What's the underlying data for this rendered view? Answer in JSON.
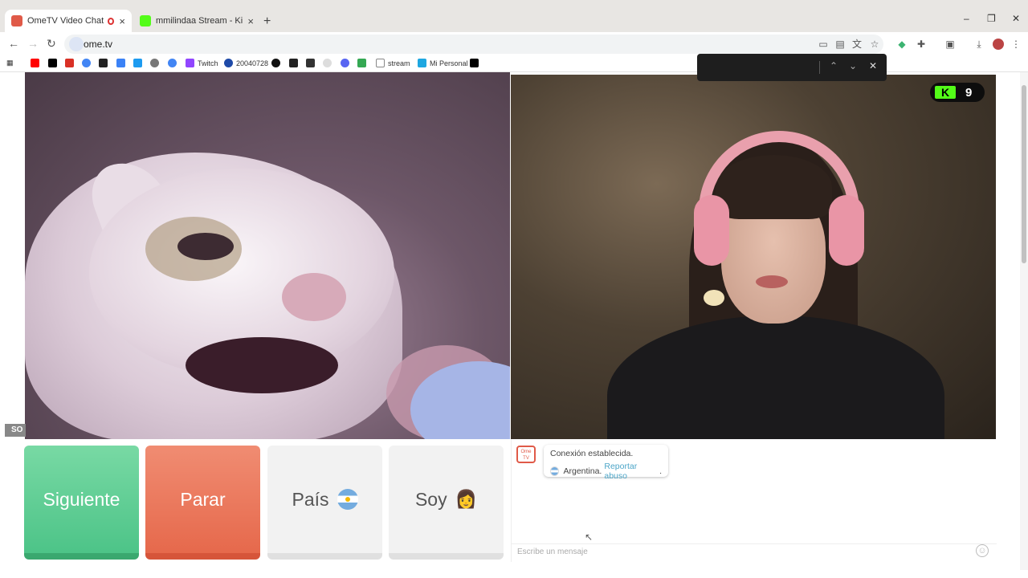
{
  "tabs": [
    {
      "title": "OmeTV Video Chat — Ome",
      "close": "×",
      "color": "#e05a48"
    },
    {
      "title": "mmilindaa Stream - Kick Dashb",
      "close": "×",
      "color": "#53fc18"
    }
  ],
  "new_tab": "+",
  "window_controls": {
    "minimize": "–",
    "maximize": "❐",
    "close": "✕"
  },
  "address": {
    "url": "ome.tv"
  },
  "bookmarks": [
    {
      "label": "",
      "color": "#ff0000"
    },
    {
      "label": "",
      "color": "#000000"
    },
    {
      "label": "",
      "color": "#d93025"
    },
    {
      "label": "",
      "color": "#4285f4"
    },
    {
      "label": "",
      "color": "#222222"
    },
    {
      "label": "",
      "color": "#3b82f6"
    },
    {
      "label": "",
      "color": "#1d9bf0"
    },
    {
      "label": "",
      "color": "#777777"
    },
    {
      "label": "",
      "color": "#4285f4"
    },
    {
      "label": "Twitch",
      "color": "#9146ff"
    },
    {
      "label": "20040728",
      "color": "#1e4aa8"
    },
    {
      "label": "",
      "color": "#111111"
    },
    {
      "label": "",
      "color": "#222222"
    },
    {
      "label": "",
      "color": "#333333"
    },
    {
      "label": "",
      "color": "#dddddd"
    },
    {
      "label": "",
      "color": "#5865f2"
    },
    {
      "label": "",
      "color": "#34a853"
    },
    {
      "label": "stream",
      "color": "#888888"
    },
    {
      "label": "Mi Personal",
      "color": "#1ea7e1"
    },
    {
      "label": "",
      "color": "#000000"
    }
  ],
  "findbar": {
    "up": "⌃",
    "down": "⌄",
    "close": "✕"
  },
  "kick_badge": {
    "logo": "K",
    "count": "9"
  },
  "watermark": "SO",
  "buttons": {
    "next": "Siguiente",
    "stop": "Parar",
    "country": "País",
    "soy": "Soy",
    "soy_emoji": "👩"
  },
  "chat": {
    "logo": "Ome TV",
    "line1": "Conexión establecida.",
    "country": "Argentina.",
    "report": "Reportar abuso",
    "report_suffix": ".",
    "placeholder": "Escribe un mensaje",
    "smile": "☺"
  },
  "colors": {
    "next": "#4dc488",
    "stop": "#e6694c",
    "kick_green": "#53fc18",
    "report_link": "#4da6c8"
  }
}
